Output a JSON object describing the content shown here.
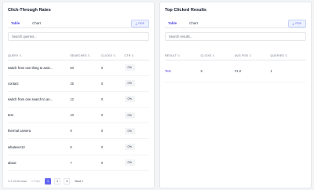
{
  "ctr_panel": {
    "title": "Click-Through Rates",
    "tabs": [
      "Table",
      "Chart"
    ],
    "pdf_label": "PDF",
    "search_placeholder": "Search queries...",
    "columns": [
      "QUERY",
      "SEARCHES",
      "CLICKS",
      "CTR"
    ],
    "rows": [
      {
        "query": "switch from one thing to anot...",
        "searches": "50",
        "clicks": "0",
        "ctr": "0%"
      },
      {
        "query": "contact",
        "searches": "25",
        "clicks": "0",
        "ctr": "0%"
      },
      {
        "query": "switch from one search to an...",
        "searches": "12",
        "clicks": "0",
        "ctr": "0%"
      },
      {
        "query": "test",
        "searches": "10",
        "clicks": "0",
        "ctr": "0%"
      },
      {
        "query": "thermal camera",
        "searches": "9",
        "clicks": "0",
        "ctr": "0%"
      },
      {
        "query": "whatever12",
        "searches": "8",
        "clicks": "0",
        "ctr": "0%"
      },
      {
        "query": "about",
        "searches": "7",
        "clicks": "0",
        "ctr": "0%"
      }
    ],
    "pagination": {
      "summary": "1-7 of 20 rows",
      "prev": "« Prev",
      "pages": [
        "1",
        "2",
        "3"
      ],
      "next": "Next »"
    }
  },
  "top_panel": {
    "title": "Top Clicked Results",
    "tabs": [
      "Table",
      "Chart"
    ],
    "pdf_label": "PDF",
    "search_placeholder": "Search results...",
    "columns": [
      "RESULT",
      "CLICKS",
      "AVG POS",
      "QUERIES"
    ],
    "rows": [
      {
        "result": "Test",
        "clicks": "5",
        "avg_pos": "#1.0",
        "queries": "1"
      }
    ]
  },
  "colors": {
    "accent": "#4f46e5",
    "background": "#f3f4f6",
    "panel": "#ffffff"
  }
}
